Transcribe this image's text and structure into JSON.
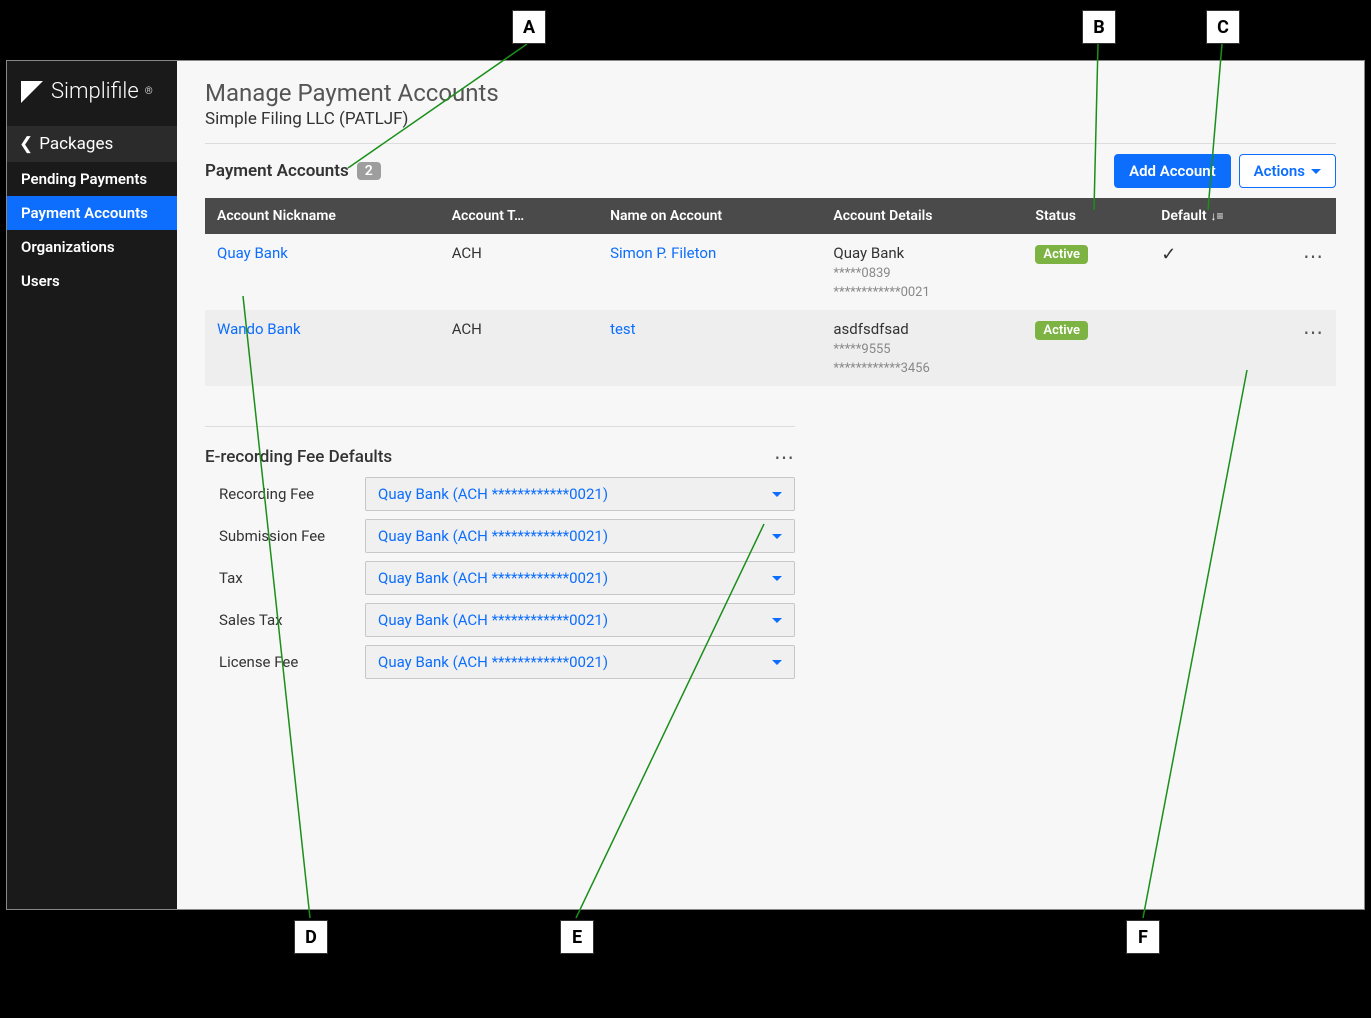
{
  "brand": "Simplifile",
  "sidebar": {
    "back_label": "Packages",
    "items": [
      {
        "label": "Pending Payments"
      },
      {
        "label": "Payment Accounts"
      },
      {
        "label": "Organizations"
      },
      {
        "label": "Users"
      }
    ]
  },
  "page": {
    "title": "Manage Payment Accounts",
    "org": "Simple Filing LLC (PATLJF)"
  },
  "accounts": {
    "section_label": "Payment Accounts",
    "count": "2",
    "add_label": "Add Account",
    "actions_label": "Actions",
    "columns": {
      "nickname": "Account Nickname",
      "type": "Account T…",
      "name": "Name on Account",
      "details": "Account Details",
      "status": "Status",
      "default": "Default"
    },
    "rows": [
      {
        "nickname": "Quay Bank",
        "type": "ACH",
        "name": "Simon P. Fileton",
        "details_line1": "Quay Bank",
        "details_line2": "*****0839",
        "details_line3": "************0021",
        "status": "Active",
        "is_default": true
      },
      {
        "nickname": "Wando Bank",
        "type": "ACH",
        "name": "test",
        "details_line1": "asdfsdfsad",
        "details_line2": "*****9555",
        "details_line3": "************3456",
        "status": "Active",
        "is_default": false
      }
    ]
  },
  "fees": {
    "section_label": "E-recording Fee Defaults",
    "selected_value": "Quay Bank (ACH ************0021)",
    "items": [
      {
        "label": "Recording Fee"
      },
      {
        "label": "Submission Fee"
      },
      {
        "label": "Tax"
      },
      {
        "label": "Sales Tax"
      },
      {
        "label": "License Fee"
      }
    ]
  },
  "annotations": [
    "A",
    "B",
    "C",
    "D",
    "E",
    "F"
  ]
}
